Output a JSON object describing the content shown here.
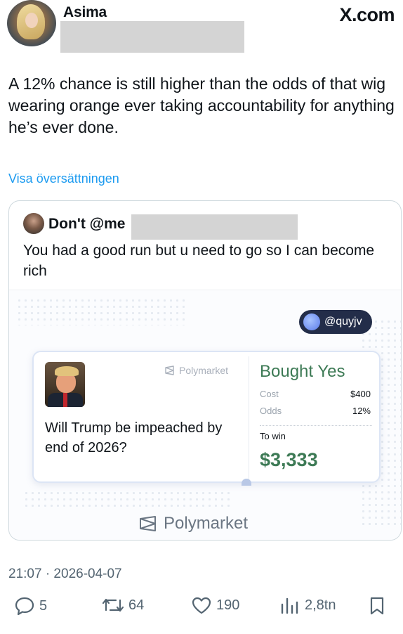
{
  "header": {
    "author_name": "Asima",
    "brand": "X.com"
  },
  "tweet": {
    "text": "A 12% chance is still higher than the odds of that wig wearing orange ever taking accountability for anything he’s ever done.",
    "translate_link": "Visa översättningen",
    "timestamp": "21:07 · 2026-04-07"
  },
  "quote": {
    "author_name": "Don't @me",
    "text": "You had a good run but u need to go so I can become rich",
    "media": {
      "handle": "@quyjv",
      "card": {
        "source": "Polymarket",
        "question": "Will Trump be impeached by end of 2026?",
        "status": "Bought Yes",
        "cost_label": "Cost",
        "cost_value": "$400",
        "odds_label": "Odds",
        "odds_value": "12%",
        "to_win_label": "To win",
        "to_win_value": "$3,333"
      },
      "footer_brand": "Polymarket"
    }
  },
  "actions": {
    "replies": "5",
    "reposts": "64",
    "likes": "190",
    "views": "2,8tn"
  },
  "colors": {
    "link": "#1d9bf0",
    "green": "#3d7a55",
    "muted": "#536471",
    "handle_bg": "#232d49"
  }
}
